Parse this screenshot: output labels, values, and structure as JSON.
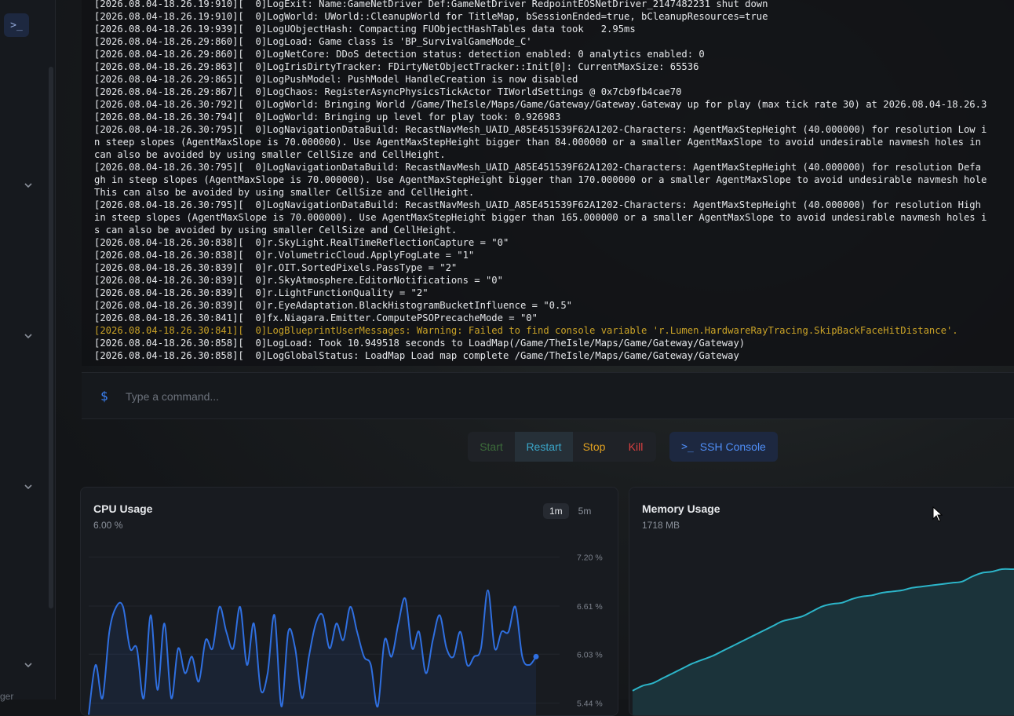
{
  "sidebar": {
    "console_icon": "terminal-icon",
    "bottom_text": "ger"
  },
  "console": {
    "lines": [
      {
        "text": "[2026.08.04-18.26.19:910][  0]LogExit: Name:GameNetDriver Def:GameNetDriver RedpointEOSNetDriver_2147482231 shut down",
        "level": "info"
      },
      {
        "text": "[2026.08.04-18.26.19:910][  0]LogWorld: UWorld::CleanupWorld for TitleMap, bSessionEnded=true, bCleanupResources=true",
        "level": "info"
      },
      {
        "text": "[2026.08.04-18.26.19:939][  0]LogUObjectHash: Compacting FUObjectHashTables data took   2.95ms",
        "level": "info"
      },
      {
        "text": "[2026.08.04-18.26.29:860][  0]LogLoad: Game class is 'BP_SurvivalGameMode_C'",
        "level": "info"
      },
      {
        "text": "[2026.08.04-18.26.29:860][  0]LogNetCore: DDoS detection status: detection enabled: 0 analytics enabled: 0",
        "level": "info"
      },
      {
        "text": "[2026.08.04-18.26.29:863][  0]LogIrisDirtyTracker: FDirtyNetObjectTracker::Init[0]: CurrentMaxSize: 65536",
        "level": "info"
      },
      {
        "text": "[2026.08.04-18.26.29:865][  0]LogPushModel: PushModel HandleCreation is now disabled",
        "level": "info"
      },
      {
        "text": "[2026.08.04-18.26.29:867][  0]LogChaos: RegisterAsyncPhysicsTickActor TIWorldSettings @ 0x7cb9fb4cae70",
        "level": "info"
      },
      {
        "text": "[2026.08.04-18.26.30:792][  0]LogWorld: Bringing World /Game/TheIsle/Maps/Game/Gateway/Gateway.Gateway up for play (max tick rate 30) at 2026.08.04-18.26.3",
        "level": "info"
      },
      {
        "text": "[2026.08.04-18.26.30:794][  0]LogWorld: Bringing up level for play took: 0.926983",
        "level": "info"
      },
      {
        "text": "[2026.08.04-18.26.30:795][  0]LogNavigationDataBuild: RecastNavMesh_UAID_A85E451539F62A1202-Characters: AgentMaxStepHeight (40.000000) for resolution Low i",
        "level": "info"
      },
      {
        "text": "n steep slopes (AgentMaxSlope is 70.000000). Use AgentMaxStepHeight bigger than 84.000000 or a smaller AgentMaxSlope to avoid undesirable navmesh holes in",
        "level": "info"
      },
      {
        "text": "can also be avoided by using smaller CellSize and CellHeight.",
        "level": "info"
      },
      {
        "text": "[2026.08.04-18.26.30:795][  0]LogNavigationDataBuild: RecastNavMesh_UAID_A85E451539F62A1202-Characters: AgentMaxStepHeight (40.000000) for resolution Defa",
        "level": "info"
      },
      {
        "text": "gh in steep slopes (AgentMaxSlope is 70.000000). Use AgentMaxStepHeight bigger than 170.000000 or a smaller AgentMaxSlope to avoid undesirable navmesh hole",
        "level": "info"
      },
      {
        "text": "This can also be avoided by using smaller CellSize and CellHeight.",
        "level": "info"
      },
      {
        "text": "[2026.08.04-18.26.30:795][  0]LogNavigationDataBuild: RecastNavMesh_UAID_A85E451539F62A1202-Characters: AgentMaxStepHeight (40.000000) for resolution High",
        "level": "info"
      },
      {
        "text": "in steep slopes (AgentMaxSlope is 70.000000). Use AgentMaxStepHeight bigger than 165.000000 or a smaller AgentMaxSlope to avoid undesirable navmesh holes i",
        "level": "info"
      },
      {
        "text": "s can also be avoided by using smaller CellSize and CellHeight.",
        "level": "info"
      },
      {
        "text": "[2026.08.04-18.26.30:838][  0]r.SkyLight.RealTimeReflectionCapture = \"0\"",
        "level": "info"
      },
      {
        "text": "[2026.08.04-18.26.30:838][  0]r.VolumetricCloud.ApplyFogLate = \"1\"",
        "level": "info"
      },
      {
        "text": "[2026.08.04-18.26.30:839][  0]r.OIT.SortedPixels.PassType = \"2\"",
        "level": "info"
      },
      {
        "text": "[2026.08.04-18.26.30:839][  0]r.SkyAtmosphere.EditorNotifications = \"0\"",
        "level": "info"
      },
      {
        "text": "[2026.08.04-18.26.30:839][  0]r.LightFunctionQuality = \"2\"",
        "level": "info"
      },
      {
        "text": "[2026.08.04-18.26.30:839][  0]r.EyeAdaptation.BlackHistogramBucketInfluence = \"0.5\"",
        "level": "info"
      },
      {
        "text": "[2026.08.04-18.26.30:841][  0]fx.Niagara.Emitter.ComputePSOPrecacheMode = \"0\"",
        "level": "info"
      },
      {
        "text": "[2026.08.04-18.26.30:841][  0]LogBlueprintUserMessages: Warning: Failed to find console variable 'r.Lumen.HardwareRayTracing.SkipBackFaceHitDistance'.",
        "level": "warning"
      },
      {
        "text": "[2026.08.04-18.26.30:858][  0]LogLoad: Took 10.949518 seconds to LoadMap(/Game/TheIsle/Maps/Game/Gateway/Gateway)",
        "level": "info"
      },
      {
        "text": "[2026.08.04-18.26.30:858][  0]LogGlobalStatus: LoadMap Load map complete /Game/TheIsle/Maps/Game/Gateway/Gateway",
        "level": "info"
      }
    ],
    "prompt_symbol": "$",
    "input_placeholder": "Type a command...",
    "input_value": ""
  },
  "actions": {
    "start": "Start",
    "restart": "Restart",
    "stop": "Stop",
    "kill": "Kill",
    "ssh": "SSH Console",
    "ssh_icon_glyph": ">_"
  },
  "colors": {
    "accent": "#3b82f6",
    "start": "#3c6b3a",
    "restart": "#3aa6c9",
    "stop": "#e0a020",
    "kill": "#d94040",
    "warning": "#c9a227",
    "cpu_line": "#2f6fe0",
    "mem_line": "#2cb5c9"
  },
  "cpu": {
    "title": "CPU Usage",
    "value": "6.00 %",
    "ranges": [
      "1m",
      "5m"
    ],
    "active_range": "1m"
  },
  "memory": {
    "title": "Memory Usage",
    "value": "1718 MB"
  },
  "chart_data": [
    {
      "type": "line",
      "title": "CPU Usage",
      "unit": "%",
      "yticks": [
        "7.20 %",
        "6.61 %",
        "6.03 %",
        "5.44 %"
      ],
      "ylim": [
        5.2,
        7.3
      ],
      "series": [
        {
          "values": [
            5.3,
            5.9,
            5.5,
            6.3,
            6.6,
            6.6,
            6.1,
            6.1,
            5.5,
            6.5,
            5.6,
            6.4,
            5.5,
            6.1,
            5.8,
            6.0,
            5.7,
            6.2,
            6.1,
            6.6,
            6.3,
            6.1,
            6.6,
            5.9,
            6.4,
            5.6,
            5.8,
            6.5,
            5.4,
            6.3,
            6.1,
            5.5,
            6.0,
            6.4,
            6.5,
            6.1,
            6.4,
            6.2,
            6.6,
            6.3,
            6.0,
            5.9,
            5.4,
            6.2,
            6.0,
            6.4,
            6.7,
            6.1,
            6.3,
            5.8,
            6.2,
            6.5,
            6.1,
            6.0,
            6.3,
            5.9,
            6.0,
            6.1,
            6.8,
            6.1,
            6.3,
            6.3,
            6.6,
            6.0,
            5.9,
            6.0
          ]
        }
      ]
    },
    {
      "type": "area",
      "title": "Memory Usage",
      "unit": "MB",
      "series": [
        {
          "values": [
            0.02,
            0.06,
            0.08,
            0.12,
            0.16,
            0.2,
            0.24,
            0.27,
            0.3,
            0.34,
            0.38,
            0.42,
            0.46,
            0.5,
            0.54,
            0.58,
            0.6,
            0.62,
            0.66,
            0.7,
            0.72,
            0.73,
            0.76,
            0.78,
            0.79,
            0.81,
            0.82,
            0.83,
            0.85,
            0.86,
            0.87,
            0.88,
            0.89,
            0.9,
            0.94,
            0.97,
            0.98,
            1.0,
            1.0,
            1.0
          ]
        }
      ]
    }
  ]
}
